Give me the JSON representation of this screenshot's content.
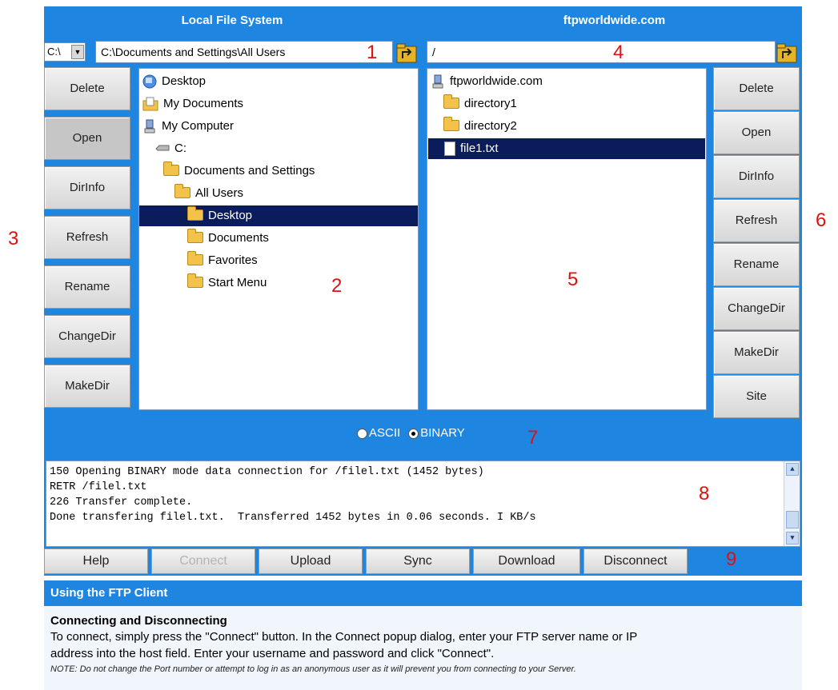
{
  "local_pane": {
    "title": "Local File System",
    "drive": "C:\\",
    "path": "C:\\Documents and Settings\\All Users",
    "buttons": [
      "Delete",
      "Open",
      "DirInfo",
      "Refresh",
      "Rename",
      "ChangeDir",
      "MakeDir"
    ],
    "tree": [
      {
        "label": "Desktop",
        "icon": "desktop-icon"
      },
      {
        "label": "My Documents",
        "icon": "my-documents-icon"
      },
      {
        "label": "My Computer",
        "icon": "computer-icon"
      },
      {
        "label": "C:",
        "icon": "drive-icon"
      },
      {
        "label": "Documents and Settings",
        "icon": "folder-icon"
      },
      {
        "label": "All Users",
        "icon": "folder-icon"
      },
      {
        "label": "Desktop",
        "icon": "folder-icon",
        "selected": true
      },
      {
        "label": "Documents",
        "icon": "folder-icon"
      },
      {
        "label": "Favorites",
        "icon": "folder-icon"
      },
      {
        "label": "Start Menu",
        "icon": "folder-icon"
      }
    ]
  },
  "remote_pane": {
    "title": "ftpworldwide.com",
    "path": "/",
    "buttons": [
      "Delete",
      "Open",
      "DirInfo",
      "Refresh",
      "Rename",
      "ChangeDir",
      "MakeDir",
      "Site"
    ],
    "tree": [
      {
        "label": "ftpworldwide.com",
        "icon": "server-icon"
      },
      {
        "label": "directory1",
        "icon": "folder-icon"
      },
      {
        "label": "directory2",
        "icon": "folder-icon"
      },
      {
        "label": "file1.txt",
        "icon": "file-icon",
        "selected": true
      }
    ]
  },
  "transfer_mode": {
    "options": [
      "ASCII",
      "BINARY"
    ],
    "selected": "BINARY"
  },
  "log": [
    "150 Opening BINARY mode data connection for /filel.txt (1452 bytes)",
    "RETR /filel.txt",
    "226 Transfer complete.",
    "Done transfering filel.txt.  Transferred 1452 bytes in 0.06 seconds. I KB/s"
  ],
  "bottom_buttons": [
    {
      "label": "Help",
      "enabled": true
    },
    {
      "label": "Connect",
      "enabled": false
    },
    {
      "label": "Upload",
      "enabled": true
    },
    {
      "label": "Sync",
      "enabled": true
    },
    {
      "label": "Download",
      "enabled": true
    },
    {
      "label": "Disconnect",
      "enabled": true
    }
  ],
  "annotations": [
    "1",
    "2",
    "3",
    "4",
    "5",
    "6",
    "7",
    "8",
    "9"
  ],
  "help": {
    "header": "Using the FTP Client",
    "section_title": "Connecting and Disconnecting",
    "para1": "To connect, simply press the \"Connect\" button. In the Connect popup dialog, enter your FTP server name or IP",
    "para2": "address into the host field. Enter your username and password and click \"Connect\".",
    "note": "NOTE: Do not change the Port number or attempt to log in as an anonymous user as it will prevent you from connecting to your Server."
  },
  "colors": {
    "frame_blue": "#1e86e0",
    "selection_navy": "#0b1c5c",
    "annotation_red": "#e01010"
  }
}
